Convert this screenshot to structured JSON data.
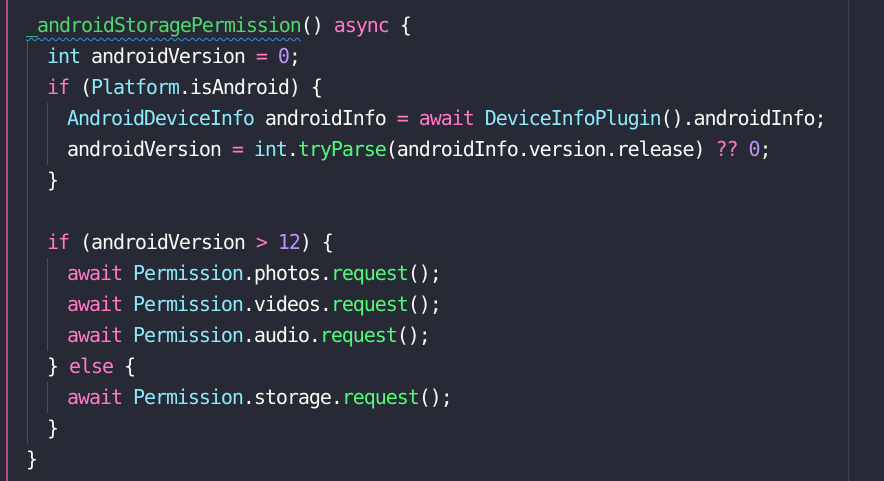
{
  "editor": {
    "lines": [
      {
        "indent": 0,
        "tokens": [
          {
            "t": "_androidStoragePermission",
            "c": "fn-def"
          },
          {
            "t": "() ",
            "c": "punct"
          },
          {
            "t": "async",
            "c": "kw"
          },
          {
            "t": " {",
            "c": "punct"
          }
        ]
      },
      {
        "indent": 1,
        "tokens": [
          {
            "t": "int",
            "c": "type"
          },
          {
            "t": " androidVersion ",
            "c": "punct"
          },
          {
            "t": "=",
            "c": "kw"
          },
          {
            "t": " ",
            "c": "punct"
          },
          {
            "t": "0",
            "c": "num"
          },
          {
            "t": ";",
            "c": "punct"
          }
        ]
      },
      {
        "indent": 1,
        "tokens": [
          {
            "t": "if",
            "c": "kw"
          },
          {
            "t": " (",
            "c": "punct"
          },
          {
            "t": "Platform",
            "c": "type"
          },
          {
            "t": ".isAndroid) {",
            "c": "punct"
          }
        ]
      },
      {
        "indent": 2,
        "tokens": [
          {
            "t": "AndroidDeviceInfo",
            "c": "type"
          },
          {
            "t": " androidInfo ",
            "c": "punct"
          },
          {
            "t": "=",
            "c": "kw"
          },
          {
            "t": " ",
            "c": "punct"
          },
          {
            "t": "await",
            "c": "kw"
          },
          {
            "t": " ",
            "c": "punct"
          },
          {
            "t": "DeviceInfoPlugin",
            "c": "type"
          },
          {
            "t": "().androidInfo;",
            "c": "punct"
          }
        ]
      },
      {
        "indent": 2,
        "tokens": [
          {
            "t": "androidVersion ",
            "c": "punct"
          },
          {
            "t": "=",
            "c": "kw"
          },
          {
            "t": " ",
            "c": "punct"
          },
          {
            "t": "int",
            "c": "type"
          },
          {
            "t": ".",
            "c": "punct"
          },
          {
            "t": "tryParse",
            "c": "fn"
          },
          {
            "t": "(androidInfo.version.release) ",
            "c": "punct"
          },
          {
            "t": "??",
            "c": "kw"
          },
          {
            "t": " ",
            "c": "punct"
          },
          {
            "t": "0",
            "c": "num"
          },
          {
            "t": ";",
            "c": "punct"
          }
        ]
      },
      {
        "indent": 1,
        "tokens": [
          {
            "t": "}",
            "c": "punct"
          }
        ]
      },
      {
        "indent": 1,
        "tokens": []
      },
      {
        "indent": 1,
        "tokens": [
          {
            "t": "if",
            "c": "kw"
          },
          {
            "t": " (androidVersion ",
            "c": "punct"
          },
          {
            "t": ">",
            "c": "kw"
          },
          {
            "t": " ",
            "c": "punct"
          },
          {
            "t": "12",
            "c": "num"
          },
          {
            "t": ") {",
            "c": "punct"
          }
        ]
      },
      {
        "indent": 2,
        "tokens": [
          {
            "t": "await",
            "c": "kw"
          },
          {
            "t": " ",
            "c": "punct"
          },
          {
            "t": "Permission",
            "c": "type"
          },
          {
            "t": ".photos.",
            "c": "punct"
          },
          {
            "t": "request",
            "c": "fn"
          },
          {
            "t": "();",
            "c": "punct"
          }
        ]
      },
      {
        "indent": 2,
        "tokens": [
          {
            "t": "await",
            "c": "kw"
          },
          {
            "t": " ",
            "c": "punct"
          },
          {
            "t": "Permission",
            "c": "type"
          },
          {
            "t": ".videos.",
            "c": "punct"
          },
          {
            "t": "request",
            "c": "fn"
          },
          {
            "t": "();",
            "c": "punct"
          }
        ]
      },
      {
        "indent": 2,
        "tokens": [
          {
            "t": "await",
            "c": "kw"
          },
          {
            "t": " ",
            "c": "punct"
          },
          {
            "t": "Permission",
            "c": "type"
          },
          {
            "t": ".audio.",
            "c": "punct"
          },
          {
            "t": "request",
            "c": "fn"
          },
          {
            "t": "();",
            "c": "punct"
          }
        ]
      },
      {
        "indent": 1,
        "tokens": [
          {
            "t": "} ",
            "c": "punct"
          },
          {
            "t": "else",
            "c": "kw"
          },
          {
            "t": " {",
            "c": "punct"
          }
        ]
      },
      {
        "indent": 2,
        "tokens": [
          {
            "t": "await",
            "c": "kw"
          },
          {
            "t": " ",
            "c": "punct"
          },
          {
            "t": "Permission",
            "c": "type"
          },
          {
            "t": ".storage.",
            "c": "punct"
          },
          {
            "t": "request",
            "c": "fn"
          },
          {
            "t": "();",
            "c": "punct"
          }
        ]
      },
      {
        "indent": 1,
        "tokens": [
          {
            "t": "}",
            "c": "punct"
          }
        ]
      },
      {
        "indent": 0,
        "tokens": [
          {
            "t": "}",
            "c": "punct"
          }
        ]
      }
    ]
  }
}
